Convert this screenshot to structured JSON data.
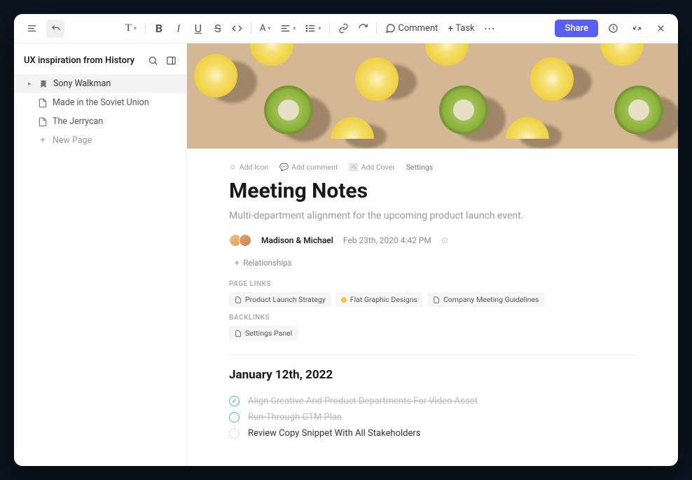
{
  "toolbar": {
    "comment_label": "Comment",
    "task_label": "Task",
    "share_label": "Share"
  },
  "sidebar": {
    "title": "UX inspiration from History",
    "items": [
      {
        "label": "Sony Walkman",
        "icon": "bookmark"
      },
      {
        "label": "Made in the Soviet Union",
        "icon": "doc"
      },
      {
        "label": "The Jerrycan",
        "icon": "doc"
      }
    ],
    "new_page_label": "New Page"
  },
  "doc": {
    "actions": {
      "add_icon": "Add Icon",
      "add_comment": "Add comment",
      "add_cover": "Add Cover",
      "settings": "Settings"
    },
    "title": "Meeting Notes",
    "subtitle": "Multi-department alignment for the upcoming product launch event.",
    "authors": "Madison & Michael",
    "date": "Feb 23th, 2020  4:42 PM",
    "relationships_label": "Relationships",
    "page_links_label": "PAGE LINKS",
    "page_links": [
      {
        "label": "Product Launch Strategy",
        "type": "doc"
      },
      {
        "label": "Flat Graphic Designs",
        "type": "dot"
      },
      {
        "label": "Company Meeting Guidelines",
        "type": "doc"
      }
    ],
    "backlinks_label": "BACKLINKS",
    "backlinks": [
      {
        "label": "Settings Panel",
        "type": "doc"
      }
    ],
    "section_heading": "January 12th, 2022",
    "tasks": [
      {
        "label": "Align Creative And Product Departments For Video Asset",
        "state": "done"
      },
      {
        "label": "Run-Through GTM Plan",
        "state": "done"
      },
      {
        "label": "Review Copy Snippet With All Stakeholders",
        "state": "open"
      }
    ]
  }
}
